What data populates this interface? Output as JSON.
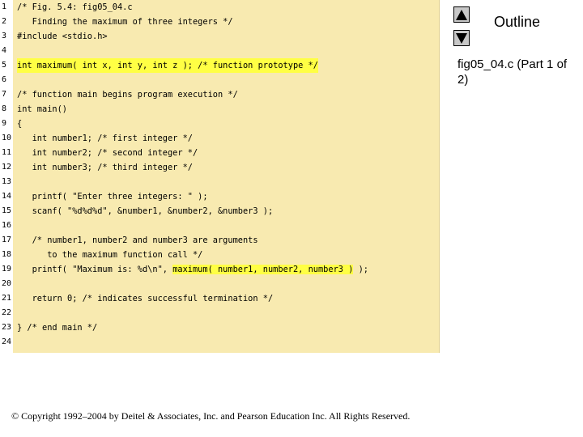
{
  "code_lines": [
    {
      "n": "1",
      "text": "/* Fig. 5.4: fig05_04.c",
      "hl": false
    },
    {
      "n": "2",
      "text": "   Finding the maximum of three integers */",
      "hl": false
    },
    {
      "n": "3",
      "text": "#include <stdio.h>",
      "hl": false
    },
    {
      "n": "4",
      "text": "",
      "hl": false
    },
    {
      "n": "5",
      "text": "int maximum( int x, int y, int z ); /* function prototype */",
      "hl": true
    },
    {
      "n": "6",
      "text": "",
      "hl": false
    },
    {
      "n": "7",
      "text": "/* function main begins program execution */",
      "hl": false
    },
    {
      "n": "8",
      "text": "int main()",
      "hl": false
    },
    {
      "n": "9",
      "text": "{",
      "hl": false
    },
    {
      "n": "10",
      "text": "   int number1; /* first integer */",
      "hl": false
    },
    {
      "n": "11",
      "text": "   int number2; /* second integer */",
      "hl": false
    },
    {
      "n": "12",
      "text": "   int number3; /* third integer */",
      "hl": false
    },
    {
      "n": "13",
      "text": "",
      "hl": false
    },
    {
      "n": "14",
      "text": "   printf( \"Enter three integers: \" );",
      "hl": false
    },
    {
      "n": "15",
      "text": "   scanf( \"%d%d%d\", &number1, &number2, &number3 );",
      "hl": false
    },
    {
      "n": "16",
      "text": "",
      "hl": false
    },
    {
      "n": "17",
      "text": "   /* number1, number2 and number3 are arguments",
      "hl": false
    },
    {
      "n": "18",
      "text": "      to the maximum function call */",
      "hl": false
    },
    {
      "n": "19",
      "text": "   printf( \"Maximum is: %d\\n\", maximum( number1, number2, number3 ) );",
      "hl": false,
      "hl_span": "maximum( number1, number2, number3 )"
    },
    {
      "n": "20",
      "text": "",
      "hl": false
    },
    {
      "n": "21",
      "text": "   return 0; /* indicates successful termination */",
      "hl": false
    },
    {
      "n": "22",
      "text": "",
      "hl": false
    },
    {
      "n": "23",
      "text": "} /* end main */",
      "hl": false
    },
    {
      "n": "24",
      "text": "",
      "hl": false
    }
  ],
  "sidebar": {
    "outline_title": "Outline",
    "file_label": "fig05_04.c (Part 1 of 2)",
    "up_icon": "triangle-up-icon",
    "down_icon": "triangle-down-icon"
  },
  "footer": {
    "copyright": "© Copyright 1992–2004 by Deitel & Associates, Inc. and Pearson Education Inc. All Rights Reserved."
  },
  "colors": {
    "code_background": "#f8eab0",
    "highlight": "#ffff44",
    "button_gray": "#c8c8c8"
  }
}
